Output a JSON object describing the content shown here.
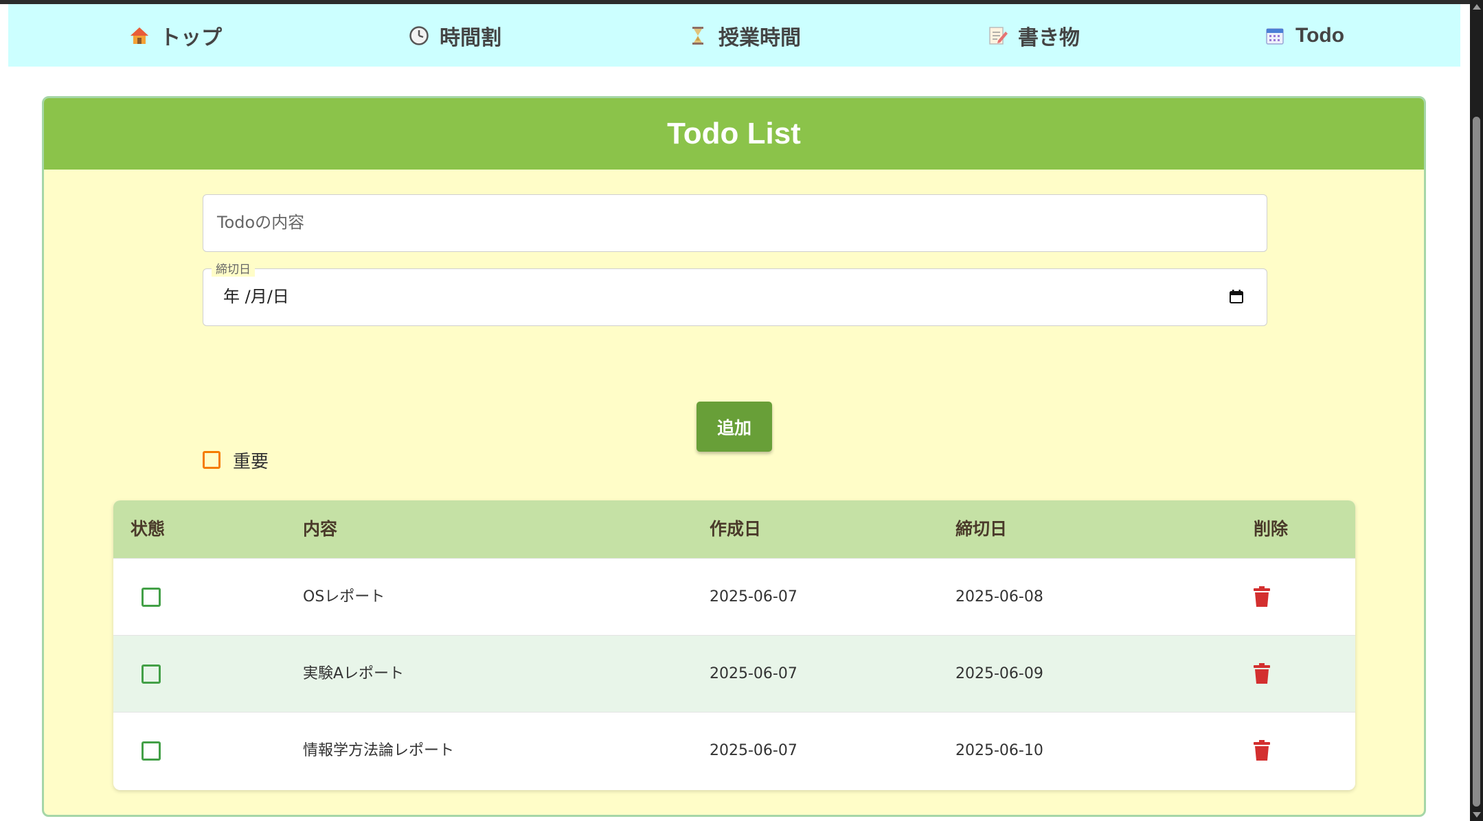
{
  "nav": {
    "items": [
      {
        "label": "トップ",
        "icon": "house-icon"
      },
      {
        "label": "時間割",
        "icon": "clock-icon"
      },
      {
        "label": "授業時間",
        "icon": "hourglass-icon"
      },
      {
        "label": "書き物",
        "icon": "memo-icon"
      },
      {
        "label": "Todo",
        "icon": "calendar-icon"
      }
    ]
  },
  "card": {
    "title": "Todo List",
    "todo_placeholder": "Todoの内容",
    "date_label": "締切日",
    "date_value": "年 /月/日",
    "important_label": "重要",
    "add_button": "追加"
  },
  "table": {
    "headers": [
      "状態",
      "内容",
      "作成日",
      "締切日",
      "削除"
    ],
    "rows": [
      {
        "content": "OSレポート",
        "created": "2025-06-07",
        "deadline": "2025-06-08",
        "done": false
      },
      {
        "content": "実験Aレポート",
        "created": "2025-06-07",
        "deadline": "2025-06-09",
        "done": false
      },
      {
        "content": "情報学方法論レポート",
        "created": "2025-06-07",
        "deadline": "2025-06-10",
        "done": false
      }
    ]
  },
  "colors": {
    "nav_bg": "#ccffff",
    "header_green": "#8bc34a",
    "card_bg": "#fffdc8",
    "button_green": "#689f38",
    "table_header": "#c5e1a5",
    "delete_red": "#d32f2f",
    "important_orange": "#f57c00"
  }
}
